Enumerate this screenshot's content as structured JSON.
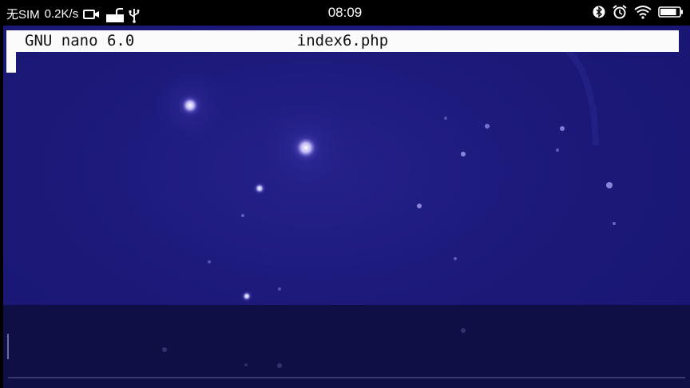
{
  "status_bar": {
    "carrier": "无SIM",
    "network_speed": "0.2K/s",
    "time": "08:09",
    "battery_level": 0.85,
    "icons_left": [
      "video-icon",
      "keyboard-icon",
      "usb-icon"
    ],
    "icons_right": [
      "bluetooth-icon",
      "alarm-icon",
      "wifi-icon",
      "battery-icon"
    ]
  },
  "nano": {
    "version": "GNU nano 6.0",
    "filename": "index6.php"
  },
  "colors": {
    "terminal_bg": "#1c197a",
    "titlebar_bg": "#fbfbfb",
    "bottom_bg": "#100f45"
  }
}
